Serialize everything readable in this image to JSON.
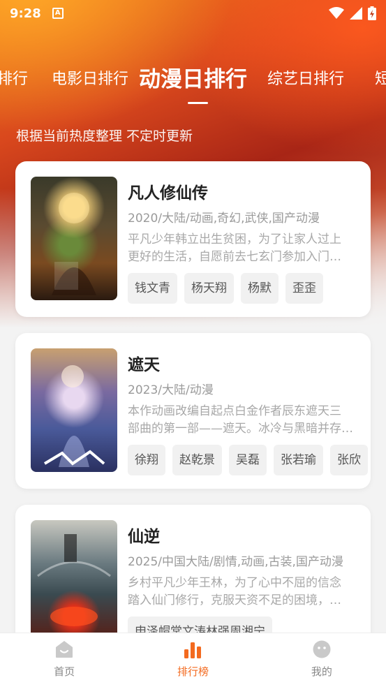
{
  "status_bar": {
    "time": "9:28",
    "notification_icon": "a-icon"
  },
  "tabs": [
    {
      "label": "排行"
    },
    {
      "label": "电影日排行"
    },
    {
      "label": "动漫日排行"
    },
    {
      "label": "综艺日排行"
    },
    {
      "label": "短"
    }
  ],
  "active_tab_index": 2,
  "subtitle": "根据当前热度整理 不定时更新",
  "items": [
    {
      "title": "凡人修仙传",
      "meta": "2020/大陆/动画,奇幻,武侠,国产动漫",
      "desc_line1": "平凡少年韩立出生贫困，为了让家人过上",
      "desc_line2": "更好的生活，自愿前去七玄门参加入门…",
      "tags": [
        "钱文青",
        "杨天翔",
        "杨默",
        "歪歪"
      ]
    },
    {
      "title": "遮天",
      "meta": "2023/大陆/动漫",
      "desc_line1": "本作动画改编自起点白金作者辰东遮天三",
      "desc_line2": "部曲的第一部——遮天。冰冷与黑暗并存…",
      "tags": [
        "徐翔",
        "赵乾景",
        "吴磊",
        "张若瑜",
        "张欣"
      ]
    },
    {
      "title": "仙逆",
      "meta": "2025/中国大陆/剧情,动画,古装,国产动漫",
      "desc_line1": "乡村平凡少年王林，为了心中不屈的信念",
      "desc_line2": "踏入仙门修行，克服天资不足的困境，…",
      "tags": [
        "申泽帽常文涛林强周湘宁"
      ]
    }
  ],
  "bottom_nav": [
    {
      "label": "首页",
      "icon": "home-icon"
    },
    {
      "label": "排行榜",
      "icon": "ranking-icon"
    },
    {
      "label": "我的",
      "icon": "profile-icon"
    }
  ],
  "colors": {
    "accent": "#f36a1f",
    "hero_top": "#f07a1a",
    "hero_mid": "#a82516"
  }
}
